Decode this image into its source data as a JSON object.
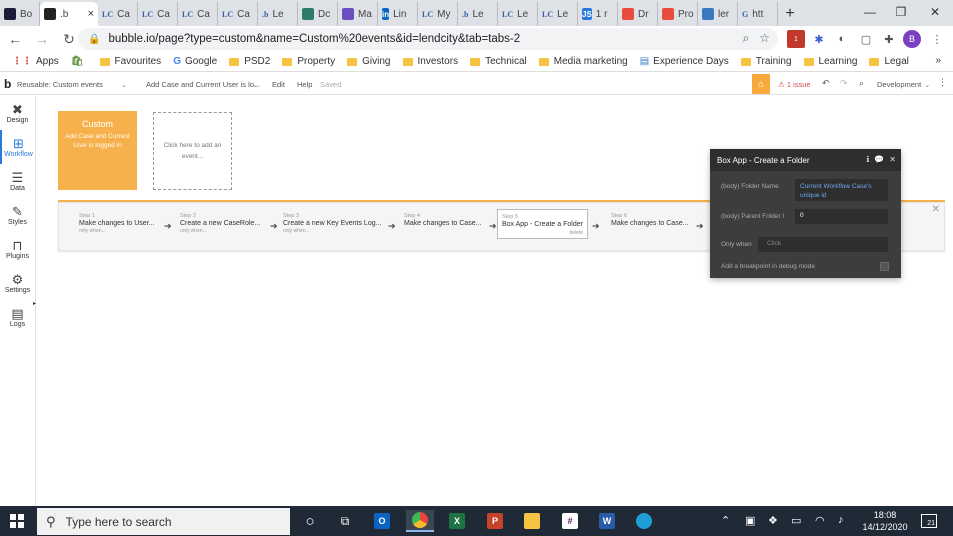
{
  "browser": {
    "tabs": [
      {
        "label": "Bo",
        "icon": "bubble-icon",
        "color": "#1d1d3a"
      },
      {
        "label": ".b",
        "icon": "bubble-b-icon",
        "color": "#222222",
        "active": true
      },
      {
        "label": "Ca",
        "icon": "lc-icon",
        "prefix": "LC"
      },
      {
        "label": "Ca",
        "icon": "lc-icon",
        "prefix": "LC"
      },
      {
        "label": "Ca",
        "icon": "lc-icon",
        "prefix": "LC"
      },
      {
        "label": "Ca",
        "icon": "lc-icon",
        "prefix": "LC"
      },
      {
        "label": "Le",
        "icon": "bubble-b-icon",
        "prefix": ".b"
      },
      {
        "label": "Dc",
        "icon": "doc-icon",
        "color": "#2e7d6b"
      },
      {
        "label": "Ma",
        "icon": "circle-icon",
        "color": "#6b4fc0"
      },
      {
        "label": "Lin",
        "icon": "linkedin-icon",
        "color": "#0a66c2",
        "prefix": "in"
      },
      {
        "label": "My",
        "icon": "lc-icon",
        "prefix": "LC"
      },
      {
        "label": "Le",
        "icon": "bubble-b-icon",
        "prefix": ".b"
      },
      {
        "label": "Le",
        "icon": "lc-icon",
        "prefix": "LC"
      },
      {
        "label": "Le",
        "icon": "lc-icon",
        "prefix": "LC"
      },
      {
        "label": "1 r",
        "icon": "js-icon",
        "color": "#2a7ade",
        "prefix": "JS"
      },
      {
        "label": "Dr",
        "icon": "figma-icon",
        "color": "#e84c3d"
      },
      {
        "label": "Pro",
        "icon": "figma-icon",
        "color": "#e84c3d"
      },
      {
        "label": "ler",
        "icon": "link-icon",
        "color": "#3a78c2"
      },
      {
        "label": "htt",
        "icon": "google-icon",
        "prefix": "G"
      }
    ],
    "close_tab": "×",
    "new_tab": "+",
    "window_controls": [
      "—",
      "❐",
      "✕"
    ],
    "url": "bubble.io/page?type=custom&name=Custom%20events&id=lendcity&tab=tabs-2",
    "profile_initial": "B",
    "extension_badge": "1"
  },
  "bookmarks": [
    {
      "label": "Apps",
      "icon": "apps-icon"
    },
    {
      "label": "",
      "icon": "shopify-icon"
    },
    {
      "label": "Favourites",
      "icon": "folder-icon"
    },
    {
      "label": "Google",
      "icon": "google-icon",
      "glyph": "G"
    },
    {
      "label": "PSD2",
      "icon": "folder-icon"
    },
    {
      "label": "Property",
      "icon": "folder-icon"
    },
    {
      "label": "Giving",
      "icon": "folder-icon"
    },
    {
      "label": "Investors",
      "icon": "folder-icon"
    },
    {
      "label": "Technical",
      "icon": "folder-icon"
    },
    {
      "label": "Media marketing",
      "icon": "folder-icon"
    },
    {
      "label": "Experience Days",
      "icon": "page-icon"
    },
    {
      "label": "Training",
      "icon": "folder-icon"
    },
    {
      "label": "Learning",
      "icon": "folder-icon"
    },
    {
      "label": "Legal",
      "icon": "folder-icon"
    }
  ],
  "bookmarks_more": "»",
  "editor": {
    "logo": "b",
    "page_selector": "Reusable: Custom events",
    "event_selector": "Add Case and Current User is lo...",
    "menu": [
      "Edit",
      "Help"
    ],
    "saved_status": "Saved",
    "issue_count": "1 issue",
    "environment": "Development"
  },
  "sidebar": [
    {
      "label": "Design",
      "icon": "design-icon"
    },
    {
      "label": "Workflow",
      "icon": "workflow-icon",
      "active": true
    },
    {
      "label": "Data",
      "icon": "database-icon"
    },
    {
      "label": "Styles",
      "icon": "brush-icon"
    },
    {
      "label": "Plugins",
      "icon": "plugins-icon"
    },
    {
      "label": "Settings",
      "icon": "gear-icon"
    },
    {
      "label": "Logs",
      "icon": "logs-icon"
    }
  ],
  "event_card": {
    "title": "Custom",
    "subtitle": "Add Case and Current User is logged in"
  },
  "add_event": "Click here to add an event...",
  "steps": [
    {
      "num": "Step 1",
      "name": "Make changes to User...",
      "cond": "only when..."
    },
    {
      "num": "Step 2",
      "name": "Create a new CaseRole...",
      "cond": "only when..."
    },
    {
      "num": "Step 3",
      "name": "Create a new Key Events Log...",
      "cond": "only when..."
    },
    {
      "num": "Step 4",
      "name": "Make changes to Case...",
      "cond": ""
    },
    {
      "num": "Step 5",
      "name": "Box App - Create a Folder",
      "cond": "",
      "selected": true,
      "delete": "delete"
    },
    {
      "num": "Step 6",
      "name": "Make changes to Case...",
      "cond": ""
    }
  ],
  "panel": {
    "title": "Box App - Create a Folder",
    "fields": [
      {
        "label": "(body) Folder Name",
        "value": "Current Workflow Case's unique id"
      },
      {
        "label": "(body) Parent Folder I",
        "value": "0"
      },
      {
        "label": "Only when",
        "value": "Click"
      }
    ],
    "breakpoint": "Add a breakpoint in debug mode"
  },
  "taskbar": {
    "search_placeholder": "Type here to search",
    "time": "18:08",
    "date": "14/12/2020",
    "notifications": "21",
    "apps": [
      {
        "icon": "cortana-icon"
      },
      {
        "icon": "task-view-icon"
      },
      {
        "icon": "outlook-icon",
        "color": "#0a64c2",
        "letter": "O"
      },
      {
        "icon": "chrome-icon",
        "color": "#e8453c",
        "active": true
      },
      {
        "icon": "excel-icon",
        "color": "#1e7244",
        "letter": "X"
      },
      {
        "icon": "powerpoint-icon",
        "color": "#c54329",
        "letter": "P"
      },
      {
        "icon": "file-explorer-icon",
        "color": "#f5c542"
      },
      {
        "icon": "slack-icon",
        "color": "#ffffff"
      },
      {
        "icon": "word-icon",
        "color": "#2a5ba8",
        "letter": "W"
      },
      {
        "icon": "edge-icon",
        "color": "#1f9ed8"
      }
    ]
  }
}
